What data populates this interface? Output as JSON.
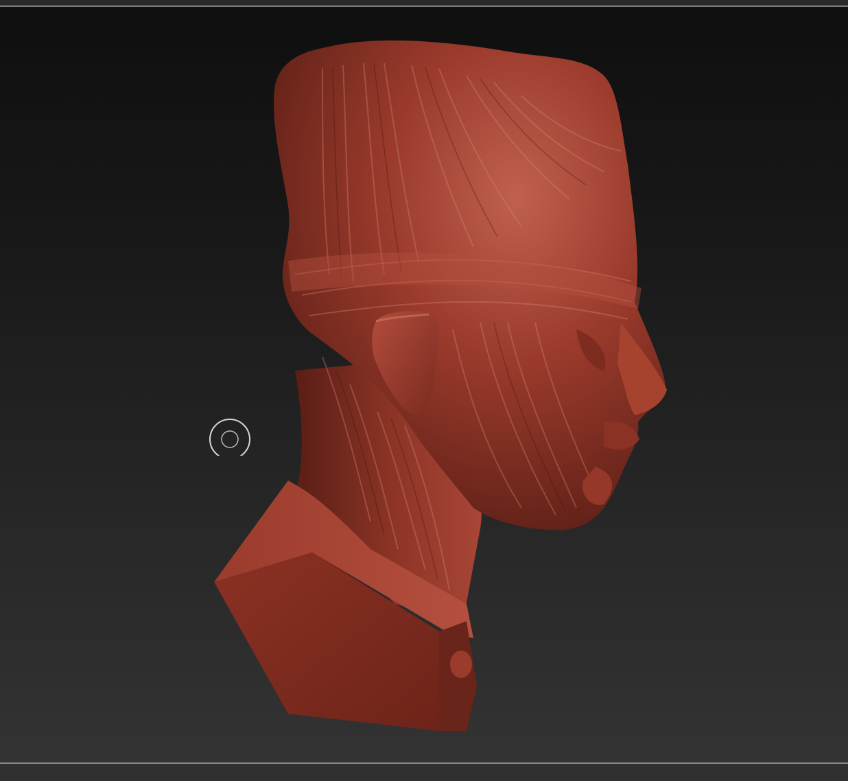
{
  "app": {
    "name": "",
    "mode": "3d-sculpt-viewport"
  },
  "viewport": {
    "background_top": "#0f0f0f",
    "background_bottom": "#333333",
    "frame_color": "#7e7e7e"
  },
  "model": {
    "subject": "sculpted-head-bust",
    "material_color": "#8c3326",
    "highlight_color": "#c0604e",
    "shadow_color": "#4e1a12"
  },
  "cursor": {
    "icon": "brush-cursor-icon",
    "color": "#d8d8d8"
  }
}
